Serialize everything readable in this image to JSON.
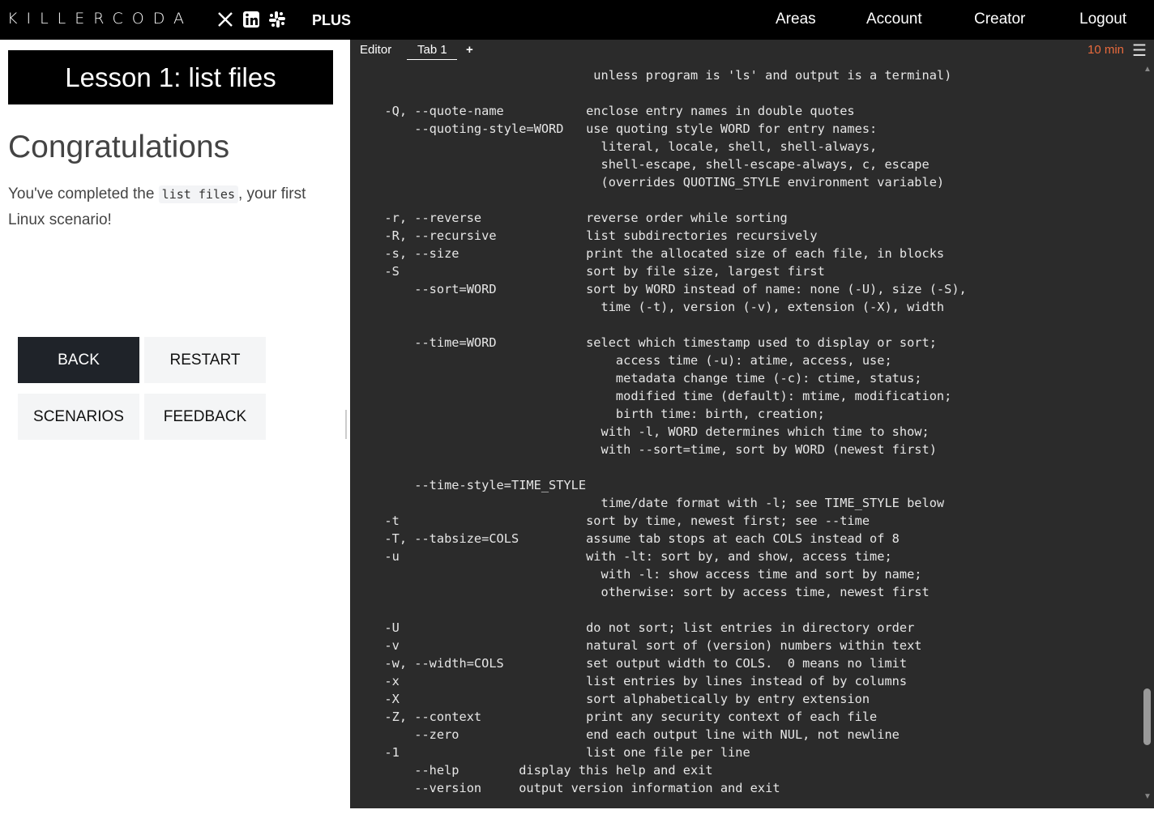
{
  "topbar": {
    "logo": "KILLERCODA",
    "social_icons": [
      "x-icon",
      "linkedin-icon",
      "slack-icon"
    ],
    "plus_label": "PLUS",
    "nav": [
      "Areas",
      "Account",
      "Creator",
      "Logout"
    ]
  },
  "lesson": {
    "title": "Lesson 1: list files",
    "heading": "Congratulations",
    "text_before": "You've completed the ",
    "code": "list files",
    "text_after": ", your first Linux scenario!"
  },
  "buttons": {
    "back": "BACK",
    "restart": "RESTART",
    "scenarios": "SCENARIOS",
    "feedback": "FEEDBACK"
  },
  "terminal_header": {
    "editor_tab": "Editor",
    "tab1": "Tab 1",
    "add_tab": "+",
    "timer": "10 min"
  },
  "terminal": {
    "lines": [
      "                              unless program is 'ls' and output is a terminal)",
      "",
      "  -Q, --quote-name           enclose entry names in double quotes",
      "      --quoting-style=WORD   use quoting style WORD for entry names:",
      "                               literal, locale, shell, shell-always,",
      "                               shell-escape, shell-escape-always, c, escape",
      "                               (overrides QUOTING_STYLE environment variable)",
      "",
      "  -r, --reverse              reverse order while sorting",
      "  -R, --recursive            list subdirectories recursively",
      "  -s, --size                 print the allocated size of each file, in blocks",
      "  -S                         sort by file size, largest first",
      "      --sort=WORD            sort by WORD instead of name: none (-U), size (-S),",
      "                               time (-t), version (-v), extension (-X), width",
      "",
      "      --time=WORD            select which timestamp used to display or sort;",
      "                                 access time (-u): atime, access, use;",
      "                                 metadata change time (-c): ctime, status;",
      "                                 modified time (default): mtime, modification;",
      "                                 birth time: birth, creation;",
      "                               with -l, WORD determines which time to show;",
      "                               with --sort=time, sort by WORD (newest first)",
      "",
      "      --time-style=TIME_STYLE",
      "                               time/date format with -l; see TIME_STYLE below",
      "  -t                         sort by time, newest first; see --time",
      "  -T, --tabsize=COLS         assume tab stops at each COLS instead of 8",
      "  -u                         with -lt: sort by, and show, access time;",
      "                               with -l: show access time and sort by name;",
      "                               otherwise: sort by access time, newest first",
      "",
      "  -U                         do not sort; list entries in directory order",
      "  -v                         natural sort of (version) numbers within text",
      "  -w, --width=COLS           set output width to COLS.  0 means no limit",
      "  -x                         list entries by lines instead of by columns",
      "  -X                         sort alphabetically by entry extension",
      "  -Z, --context              print any security context of each file",
      "      --zero                 end each output line with NUL, not newline",
      "  -1                         list one file per line",
      "      --help        display this help and exit",
      "      --version     output version information and exit"
    ]
  }
}
